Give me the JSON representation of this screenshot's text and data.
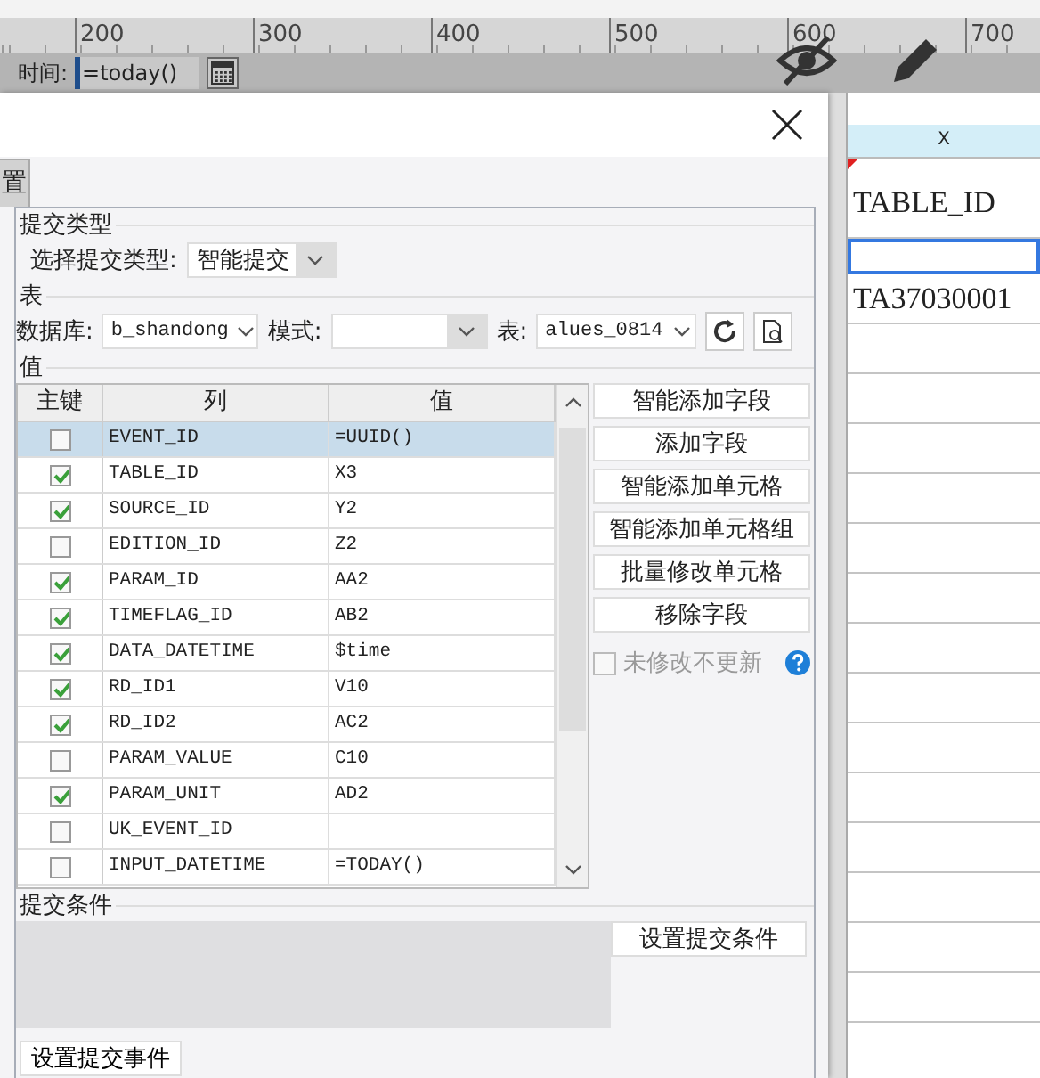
{
  "ruler": {
    "labels": [
      "200",
      "300",
      "400",
      "500",
      "600",
      "700"
    ]
  },
  "parameter_bar": {
    "label": "时间:",
    "value": "=today()"
  },
  "dialog": {
    "tab": {
      "label": "置",
      "selected": true
    },
    "submit_type": {
      "legend": "提交类型",
      "label": "选择提交类型:",
      "value": "智能提交"
    },
    "table_section": {
      "legend": "表",
      "database_label": "数据库:",
      "database": "b_shandong",
      "mode_label": "模式:",
      "table_label": "表:",
      "table": "alues_0814"
    },
    "values": {
      "legend": "值",
      "columns": [
        "主键",
        "列",
        "值"
      ],
      "rows": [
        {
          "key": false,
          "column": "EVENT_ID",
          "value": "=UUID()",
          "selected": true
        },
        {
          "key": true,
          "column": "TABLE_ID",
          "value": "X3",
          "selected": false
        },
        {
          "key": true,
          "column": "SOURCE_ID",
          "value": "Y2",
          "selected": false
        },
        {
          "key": false,
          "column": "EDITION_ID",
          "value": "Z2",
          "selected": false
        },
        {
          "key": true,
          "column": "PARAM_ID",
          "value": "AA2",
          "selected": false
        },
        {
          "key": true,
          "column": "TIMEFLAG_ID",
          "value": "AB2",
          "selected": false
        },
        {
          "key": true,
          "column": "DATA_DATETIME",
          "value": "$time",
          "selected": false
        },
        {
          "key": true,
          "column": "RD_ID1",
          "value": "V10",
          "selected": false
        },
        {
          "key": true,
          "column": "RD_ID2",
          "value": "AC2",
          "selected": false
        },
        {
          "key": false,
          "column": "PARAM_VALUE",
          "value": "C10",
          "selected": false
        },
        {
          "key": true,
          "column": "PARAM_UNIT",
          "value": "AD2",
          "selected": false
        },
        {
          "key": false,
          "column": "UK_EVENT_ID",
          "selected": false
        },
        {
          "key": false,
          "column": "INPUT_DATETIME",
          "value": "=TODAY()",
          "selected": false
        }
      ],
      "buttons": [
        "智能添加字段",
        "添加字段",
        "智能添加单元格",
        "智能添加单元格组",
        "批量修改单元格",
        "移除字段"
      ],
      "skip_unchanged": {
        "label": "未修改不更新",
        "checked": false,
        "disabled": true
      }
    },
    "condition": {
      "legend": "提交条件",
      "button": "设置提交条件"
    },
    "event_button": "设置提交事件"
  },
  "sheet": {
    "column": "X",
    "cells": [
      {
        "text": "TABLE_ID",
        "comment": true,
        "selected": false
      },
      {
        "selected": true
      },
      {
        "text": "TA37030001",
        "selected": false
      }
    ]
  }
}
